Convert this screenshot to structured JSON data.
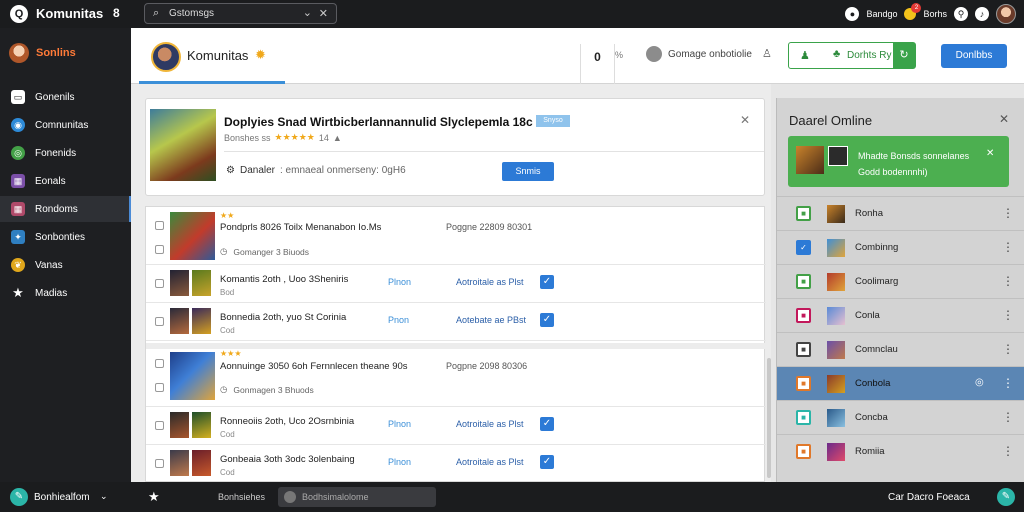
{
  "topbar": {
    "app_title": "Komunitas",
    "app_extra": "8",
    "search_text": "Gstomsgs",
    "user_label": "Bandgo",
    "notif_count": "2",
    "nav_label": "Borhs"
  },
  "sidebar": {
    "brand": "Sonlins",
    "items": [
      {
        "label": "Gonenils",
        "icon": "home-icon",
        "color": "#ffffff"
      },
      {
        "label": "Comnunitas",
        "icon": "globe-icon",
        "color": "#2d8ad8"
      },
      {
        "label": "Fonenids",
        "icon": "chat-icon",
        "color": "#43a047"
      },
      {
        "label": "Eonals",
        "icon": "game-icon",
        "color": "#7b4fa8"
      },
      {
        "label": "Rondoms",
        "icon": "dice-icon",
        "color": "#b04a6a"
      },
      {
        "label": "Sonbonties",
        "icon": "puzzle-icon",
        "color": "#2f7fc1"
      },
      {
        "label": "Vanas",
        "icon": "leaf-icon",
        "color": "#e0a71c"
      },
      {
        "label": "Madias",
        "icon": "star-icon",
        "color": "#ffffff"
      }
    ]
  },
  "header": {
    "title": "Komunitas",
    "count": "0",
    "collapse": "%",
    "user_text": "Gomage onbotiolie",
    "follow_label": "Dorhts Ry",
    "donate_label": "Donlbbs"
  },
  "featured": {
    "title": "Doplyies Snad Wirtbicberlannannulid Slyclepemla 18c",
    "tag": "Snyso",
    "meta_text": "Bonshes ss",
    "rating_text": "14",
    "status_label": "Danaler",
    "status_value": ": emnaeal onmerseny: 0gH6",
    "button_label": "Snmis"
  },
  "list": {
    "group1": {
      "stars": "★★",
      "title": "Pondprls 8026 Toilx Menanabon Io.Ms",
      "meta": "Poggne 22809 80301",
      "sub": "Gomanger 3 Biuods",
      "rows": [
        {
          "title": "Komantis 2oth , Uoo 3Sheniris",
          "sub": "Bod",
          "action": "Plnon",
          "status": "Aotroitale  as Plst"
        },
        {
          "title": "Bonnedia 2oth, yuo St Corinia",
          "sub": "Cod",
          "action": "Pnon",
          "status": "Aotebate  ae PBst"
        }
      ]
    },
    "group2": {
      "stars": "★★★",
      "title": "Aonnuinge 3050 6oh Fernnlecen theane 90s",
      "meta": "Pogpne 2098 80306",
      "sub": "Gonmagen 3 Bhuods",
      "rows": [
        {
          "title": "Ronneoiis 2oth, Uco 2Osrnbinia",
          "sub": "Cod",
          "action": "Plnon",
          "status": "Aotroitale  as Plst"
        },
        {
          "title": "Gonbeaia 3oth 3odc 3olenbaing",
          "sub": "Cod",
          "action": "Plnon",
          "status": "Aotroitale  as Plst"
        }
      ]
    }
  },
  "right_panel": {
    "title": "Daarel Omline",
    "card_line1": "Mhadte Bonsds sonnelanes",
    "card_line2": "Godd bodennnhi)",
    "rows": [
      {
        "name": "Ronha",
        "color": "#43a047",
        "icon": "square-icon",
        "active": false
      },
      {
        "name": "Combinng",
        "color": "#2c7ad6",
        "icon": "check-icon",
        "active": false
      },
      {
        "name": "Coolimarg",
        "color": "#43a047",
        "icon": "square-icon",
        "active": false
      },
      {
        "name": "Conla",
        "color": "#c2185b",
        "icon": "square-icon",
        "active": false
      },
      {
        "name": "Comnclau",
        "color": "#444444",
        "icon": "square-icon",
        "active": false
      },
      {
        "name": "Conbola",
        "color": "#e0782a",
        "icon": "square-icon",
        "active": true
      },
      {
        "name": "Concba",
        "color": "#2bb5a8",
        "icon": "square-icon",
        "active": false
      },
      {
        "name": "Romiia",
        "color": "#e0782a",
        "icon": "square-icon",
        "active": false
      }
    ]
  },
  "bottombar": {
    "label": "Bonhiealfom",
    "mid_label": "Bonhsiehes",
    "field_text": "Bodhsimalolome",
    "right_label": "Car Dacro Foeaca"
  }
}
